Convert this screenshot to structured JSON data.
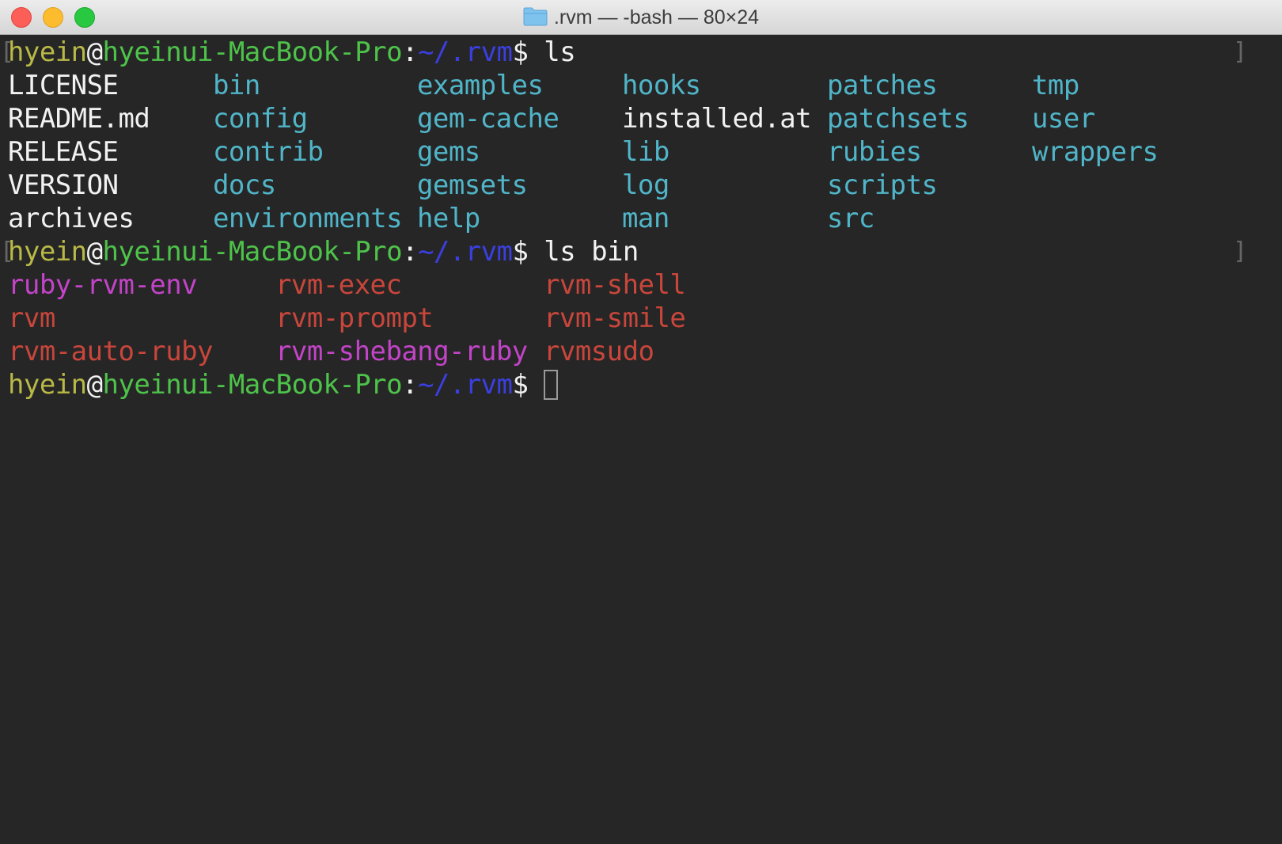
{
  "window": {
    "title": ".rvm — -bash — 80×24"
  },
  "prompt": {
    "user": "hyein",
    "at": "@",
    "host": "hyeinui-MacBook-Pro",
    "colon": ":",
    "path": "~/.rvm",
    "dollar": "$"
  },
  "commands": [
    " ls",
    " ls bin"
  ],
  "ls_rvm": [
    [
      "LICENSE",
      "bin",
      "examples",
      "hooks",
      "patches",
      "tmp"
    ],
    [
      "README.md",
      "config",
      "gem-cache",
      "installed.at",
      "patchsets",
      "user"
    ],
    [
      "RELEASE",
      "contrib",
      "gems",
      "lib",
      "rubies",
      "wrappers"
    ],
    [
      "VERSION",
      "docs",
      "gemsets",
      "log",
      "scripts"
    ],
    [
      "archives",
      "environments",
      "help",
      "man",
      "src"
    ]
  ],
  "ls_bin": [
    [
      "ruby-rvm-env",
      "rvm-exec",
      "rvm-shell"
    ],
    [
      "rvm",
      "rvm-prompt",
      "rvm-smile"
    ],
    [
      "rvm-auto-ruby",
      "rvm-shebang-ruby",
      "rvmsudo"
    ]
  ],
  "colors": {
    "user": "#b9b947",
    "host": "#4ec34a",
    "path": "#3b3fe0",
    "text": "#f2f2f2",
    "directory": "#50b5c8",
    "ls_bin_columns": [
      [
        "#c344c8",
        "#c8463b",
        "#c8463b"
      ],
      [
        "#c8463b",
        "#c8463b",
        "#c8463b"
      ],
      [
        "#c8463b",
        "#c344c8",
        "#c8463b"
      ]
    ]
  }
}
